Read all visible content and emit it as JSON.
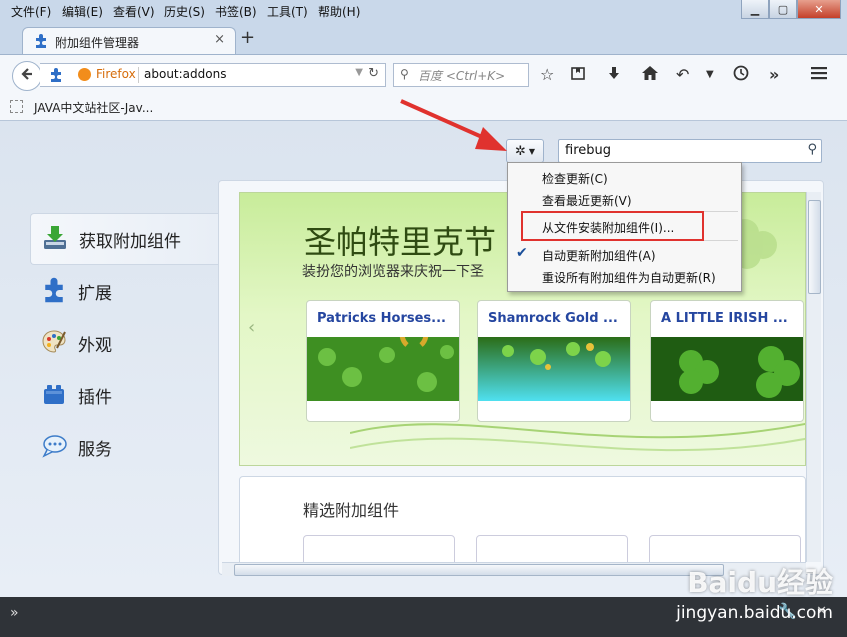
{
  "menubar": {
    "items": [
      "文件(F)",
      "编辑(E)",
      "查看(V)",
      "历史(S)",
      "书签(B)",
      "工具(T)",
      "帮助(H)"
    ]
  },
  "window_controls": {
    "minimize": "▁",
    "maximize": "▢",
    "close": "✕"
  },
  "tab": {
    "title": "附加组件管理器",
    "close": "×"
  },
  "new_tab": "+",
  "navbar": {
    "identity_label": "Firefox",
    "url": "about:addons",
    "search_placeholder": "百度 <Ctrl+K>"
  },
  "bookmarks": {
    "items": [
      "JAVA中文站社区-Jav..."
    ]
  },
  "addon_search": {
    "value": "firebug"
  },
  "sidebar": {
    "items": [
      {
        "label": "获取附加组件",
        "icon": "get-addons-icon",
        "selected": true
      },
      {
        "label": "扩展",
        "icon": "puzzle-icon"
      },
      {
        "label": "外观",
        "icon": "palette-icon"
      },
      {
        "label": "插件",
        "icon": "lego-icon"
      },
      {
        "label": "服务",
        "icon": "speech-bubble-icon"
      }
    ]
  },
  "promo": {
    "title": "圣帕特里克节",
    "subtitle": "装扮您的浏览器来庆祝一下圣",
    "themes": [
      {
        "name": "Patricks Horses..."
      },
      {
        "name": "Shamrock Gold ..."
      },
      {
        "name": "A LITTLE IRISH ..."
      }
    ]
  },
  "featured": {
    "title": "精选附加组件"
  },
  "tools_menu": {
    "items": [
      "检查更新(C)",
      "查看最近更新(V)",
      "从文件安装附加组件(I)...",
      "自动更新附加组件(A)",
      "重设所有附加组件为自动更新(R)"
    ],
    "checked_index": 3
  },
  "watermark": {
    "brand": "Baidu经验",
    "url": "jingyan.baidu.com"
  },
  "colors": {
    "accent_link": "#2546a0",
    "highlight_box": "#e0322e",
    "arrow": "#e0322e"
  }
}
